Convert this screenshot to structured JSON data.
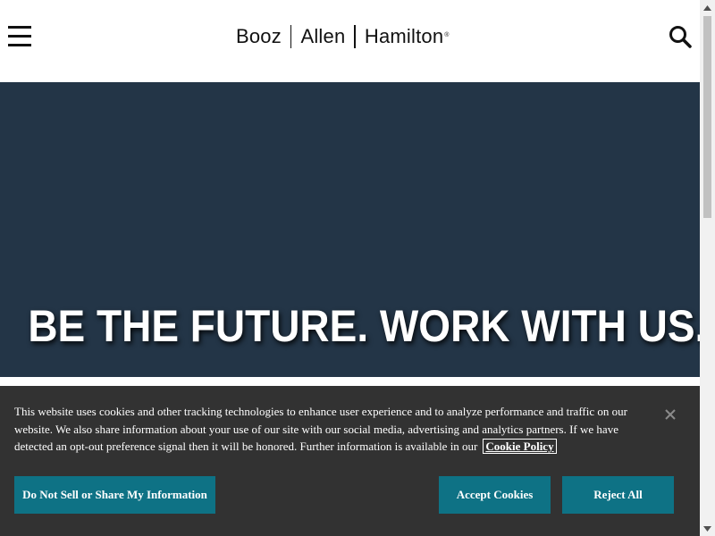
{
  "header": {
    "logo": {
      "part1": "Booz",
      "part2": "Allen",
      "part3": "Hamilton",
      "mark": "®"
    },
    "menu_icon": "hamburger-menu-icon",
    "search_icon": "search-icon"
  },
  "hero": {
    "title": "BE THE FUTURE. WORK WITH US.",
    "background_color": "#233547"
  },
  "cookie_banner": {
    "text": "This website uses cookies and other tracking technologies to enhance user experience and to analyze performance and traffic on our website. We also share information about your use of our site with our social media, advertising and analytics partners. If we have detected an opt-out preference signal then it will be honored. Further information is available in our",
    "link_label": "Cookie Policy",
    "buttons": {
      "do_not_sell": "Do Not Sell or Share My Information",
      "accept": "Accept Cookies",
      "reject": "Reject All"
    },
    "background_color": "#323232",
    "button_color": "#0e7285"
  }
}
